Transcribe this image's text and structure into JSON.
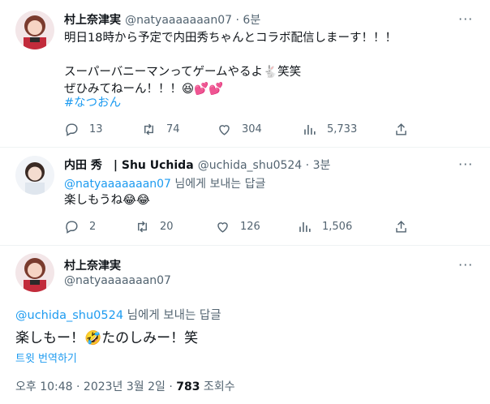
{
  "tweet1": {
    "display_name": "村上奈津実",
    "handle": "@natyaaaaaaan07",
    "time": "6분",
    "text": "明日18時から予定で内田秀ちゃんとコラボ配信しまーす！！！\n\nスーパーバニーマンってゲームやるよ🐇笑笑\nぜひみてねーん！！！😆💕💕",
    "hashtag": "#なつおん",
    "replies": "13",
    "retweets": "74",
    "likes": "304",
    "views": "5,733"
  },
  "tweet2": {
    "display_name": "内田 秀　| Shu Uchida",
    "handle": "@uchida_shu0524",
    "time": "3분",
    "reply_to": "@natyaaaaaaan07",
    "reply_suffix": " 님에게 보내는 답글",
    "text": "楽しもうね😂😂",
    "replies": "2",
    "retweets": "20",
    "likes": "126",
    "views": "1,506"
  },
  "tweet3": {
    "display_name": "村上奈津実",
    "handle": "@natyaaaaaaan07",
    "reply_to": "@uchida_shu0524",
    "reply_suffix": " 님에게 보내는 답글",
    "text": "楽しもー！🤣たのしみー！笑",
    "translate": "트윗 번역하기",
    "timestamp": "오후 10:48 · 2023년 3월 2일 · ",
    "view_count": "783",
    "view_label": " 조회수"
  },
  "more_glyph": "···",
  "dot": " · ",
  "colors": {
    "link": "#1d9bf0",
    "secondary": "#536471",
    "primary": "#0f1419",
    "divider": "#eff3f4"
  },
  "icons": [
    "more-icon",
    "reply-icon",
    "retweet-icon",
    "like-icon",
    "views-icon",
    "share-icon"
  ]
}
